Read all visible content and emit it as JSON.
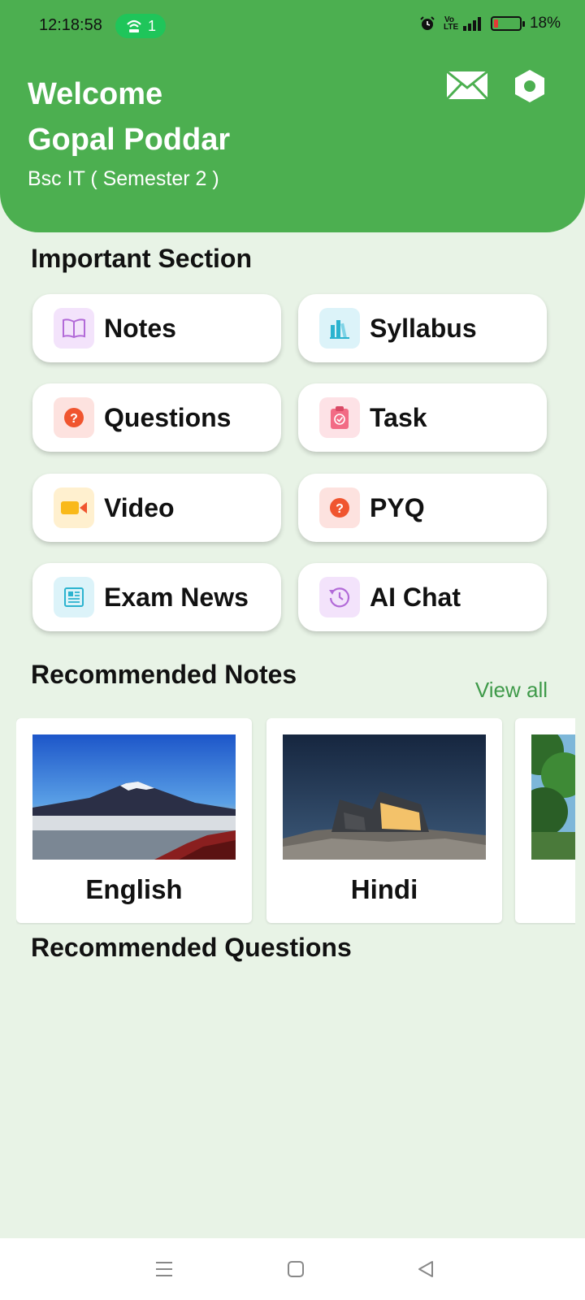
{
  "status": {
    "time": "12:18:58",
    "hotspot_count": "1",
    "volte": "Vo LTE",
    "battery": "18%",
    "battery_level": 0.18
  },
  "header": {
    "greeting": "Welcome",
    "name": "Gopal Poddar",
    "course": "Bsc IT  ( Semester 2 )",
    "icons": [
      "mail-icon",
      "settings-icon"
    ],
    "color": "#4caf50"
  },
  "important": {
    "title": "Important Section",
    "tiles": [
      {
        "label": "Notes",
        "icon": "book-icon",
        "bg": "#f3e3fb"
      },
      {
        "label": "Syllabus",
        "icon": "books-icon",
        "bg": "#dcf3f9"
      },
      {
        "label": "Questions",
        "icon": "question-icon",
        "bg": "#fde2df"
      },
      {
        "label": "Task",
        "icon": "clipboard-icon",
        "bg": "#fde2e6"
      },
      {
        "label": "Video",
        "icon": "video-camera-icon",
        "bg": "#fff0cf"
      },
      {
        "label": "PYQ",
        "icon": "question-icon",
        "bg": "#fde2df"
      },
      {
        "label": "Exam News",
        "icon": "newspaper-icon",
        "bg": "#dcf3f9"
      },
      {
        "label": "AI Chat",
        "icon": "history-icon",
        "bg": "#f3e3fb"
      }
    ]
  },
  "recommended_notes": {
    "title": "Recommended Notes",
    "view_all": "View all",
    "items": [
      {
        "label": "English",
        "image": "mountain-photo"
      },
      {
        "label": "Hindi",
        "image": "cabin-night-photo"
      },
      {
        "label": "",
        "image": "forest-photo"
      }
    ]
  },
  "recommended_questions": {
    "title": "Recommended Questions"
  },
  "navbar": {
    "icons": [
      "menu-icon",
      "home-square-icon",
      "back-triangle-icon"
    ]
  }
}
